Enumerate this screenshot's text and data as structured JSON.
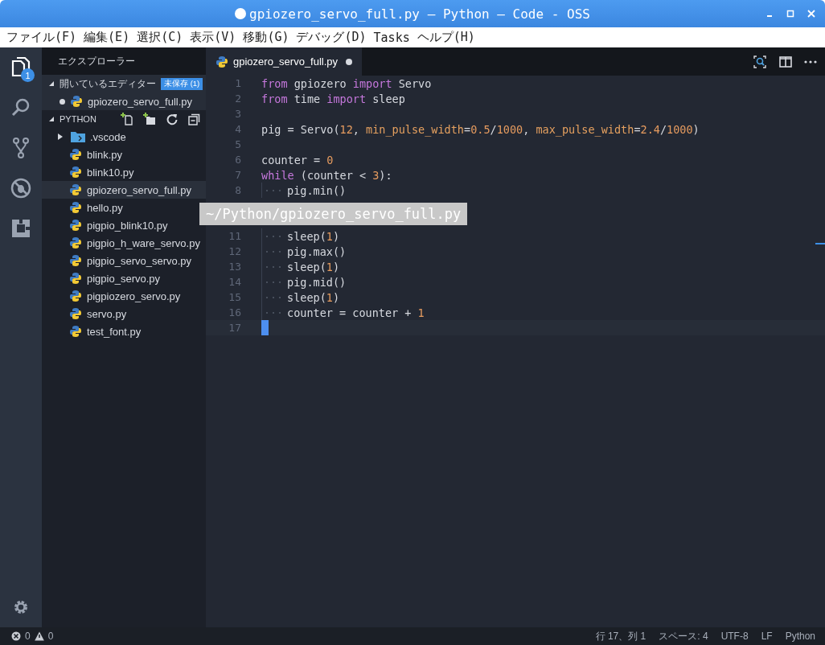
{
  "window": {
    "title": "gpiozero_servo_full.py — Python — Code - OSS",
    "dirty": true
  },
  "menu": [
    "ファイル(F)",
    "編集(E)",
    "選択(C)",
    "表示(V)",
    "移動(G)",
    "デバッグ(D)",
    "Tasks",
    "ヘルプ(H)"
  ],
  "activity_bar": {
    "badge": "1"
  },
  "sidebar": {
    "title": "エクスプローラー",
    "open_editors": {
      "label": "開いているエディター",
      "badge": "未保存 (1)",
      "expanded": true,
      "items": [
        {
          "name": "gpiozero_servo_full.py",
          "dirty": true
        }
      ]
    },
    "folder": {
      "label": "PYTHON",
      "expanded": true,
      "items": [
        {
          "name": ".vscode",
          "kind": "folder",
          "expanded": false,
          "selected": false
        },
        {
          "name": "blink.py",
          "kind": "python",
          "selected": false
        },
        {
          "name": "blink10.py",
          "kind": "python",
          "selected": false
        },
        {
          "name": "gpiozero_servo_full.py",
          "kind": "python",
          "selected": true
        },
        {
          "name": "hello.py",
          "kind": "python",
          "selected": false
        },
        {
          "name": "pigpio_blink10.py",
          "kind": "python",
          "selected": false
        },
        {
          "name": "pigpio_h_ware_servo.py",
          "kind": "python",
          "selected": false
        },
        {
          "name": "pigpio_servo_servo.py",
          "kind": "python",
          "selected": false
        },
        {
          "name": "pigpio_servo.py",
          "kind": "python",
          "selected": false
        },
        {
          "name": "pigpiozero_servo.py",
          "kind": "python",
          "selected": false
        },
        {
          "name": "servo.py",
          "kind": "python",
          "selected": false
        },
        {
          "name": "test_font.py",
          "kind": "python",
          "selected": false
        }
      ]
    }
  },
  "tabs": [
    {
      "label": "gpiozero_servo_full.py",
      "selected": true,
      "dirty": true
    }
  ],
  "editor": {
    "lines": [
      {
        "number": "1",
        "indent": false,
        "current": false,
        "tokens": [
          {
            "kind": "keyword",
            "text": "from"
          },
          {
            "kind": "plain",
            "text": " gpiozero "
          },
          {
            "kind": "keyword",
            "text": "import"
          },
          {
            "kind": "plain",
            "text": " Servo"
          }
        ]
      },
      {
        "number": "2",
        "indent": false,
        "current": false,
        "tokens": [
          {
            "kind": "keyword",
            "text": "from"
          },
          {
            "kind": "plain",
            "text": " time "
          },
          {
            "kind": "keyword",
            "text": "import"
          },
          {
            "kind": "plain",
            "text": " sleep"
          }
        ]
      },
      {
        "number": "3",
        "indent": false,
        "current": false
      },
      {
        "number": "4",
        "indent": false,
        "current": false,
        "tokens": [
          {
            "kind": "plain",
            "text": "pig = Servo("
          },
          {
            "kind": "number",
            "text": "12"
          },
          {
            "kind": "plain",
            "text": ", "
          },
          {
            "kind": "param",
            "text": "min_pulse_width"
          },
          {
            "kind": "plain",
            "text": "="
          },
          {
            "kind": "number",
            "text": "0.5"
          },
          {
            "kind": "plain",
            "text": "/"
          },
          {
            "kind": "number",
            "text": "1000"
          },
          {
            "kind": "plain",
            "text": ", "
          },
          {
            "kind": "param",
            "text": "max_pulse_width"
          },
          {
            "kind": "plain",
            "text": "="
          },
          {
            "kind": "number",
            "text": "2.4"
          },
          {
            "kind": "plain",
            "text": "/"
          },
          {
            "kind": "number",
            "text": "1000"
          },
          {
            "kind": "plain",
            "text": ")"
          }
        ]
      },
      {
        "number": "5",
        "indent": false,
        "current": false
      },
      {
        "number": "6",
        "indent": false,
        "current": false,
        "tokens": [
          {
            "kind": "plain",
            "text": "counter = "
          },
          {
            "kind": "number",
            "text": "0"
          }
        ]
      },
      {
        "number": "7",
        "indent": false,
        "current": false,
        "tokens": [
          {
            "kind": "keyword",
            "text": "while"
          },
          {
            "kind": "plain",
            "text": " (counter < "
          },
          {
            "kind": "number",
            "text": "3"
          },
          {
            "kind": "plain",
            "text": "):"
          }
        ]
      },
      {
        "number": "8",
        "indent": true,
        "current": false,
        "tokens": [
          {
            "kind": "plain",
            "text": "pig.min()"
          }
        ]
      },
      {
        "current": false
      },
      {
        "current": false
      },
      {
        "number": "11",
        "indent": true,
        "current": false,
        "tokens": [
          {
            "kind": "plain",
            "text": "sleep("
          },
          {
            "kind": "number",
            "text": "1"
          },
          {
            "kind": "plain",
            "text": ")"
          }
        ]
      },
      {
        "number": "12",
        "indent": true,
        "current": false,
        "tokens": [
          {
            "kind": "plain",
            "text": "pig.max()"
          }
        ]
      },
      {
        "number": "13",
        "indent": true,
        "current": false,
        "tokens": [
          {
            "kind": "plain",
            "text": "sleep("
          },
          {
            "kind": "number",
            "text": "1"
          },
          {
            "kind": "plain",
            "text": ")"
          }
        ]
      },
      {
        "number": "14",
        "indent": true,
        "current": false,
        "tokens": [
          {
            "kind": "plain",
            "text": "pig.mid()"
          }
        ]
      },
      {
        "number": "15",
        "indent": true,
        "current": false,
        "tokens": [
          {
            "kind": "plain",
            "text": "sleep("
          },
          {
            "kind": "number",
            "text": "1"
          },
          {
            "kind": "plain",
            "text": ")"
          }
        ]
      },
      {
        "number": "16",
        "indent": true,
        "current": false,
        "tokens": [
          {
            "kind": "plain",
            "text": "counter = counter + "
          },
          {
            "kind": "number",
            "text": "1"
          }
        ]
      },
      {
        "number": "17",
        "indent": false,
        "current": true
      }
    ]
  },
  "tooltip": "~/Python/gpiozero_servo_full.py",
  "status_bar": {
    "errors": "0",
    "warnings": "0",
    "position": "行 17、列 1",
    "spaces": "スペース: 4",
    "encoding": "UTF-8",
    "eol": "LF",
    "language": "Python"
  }
}
